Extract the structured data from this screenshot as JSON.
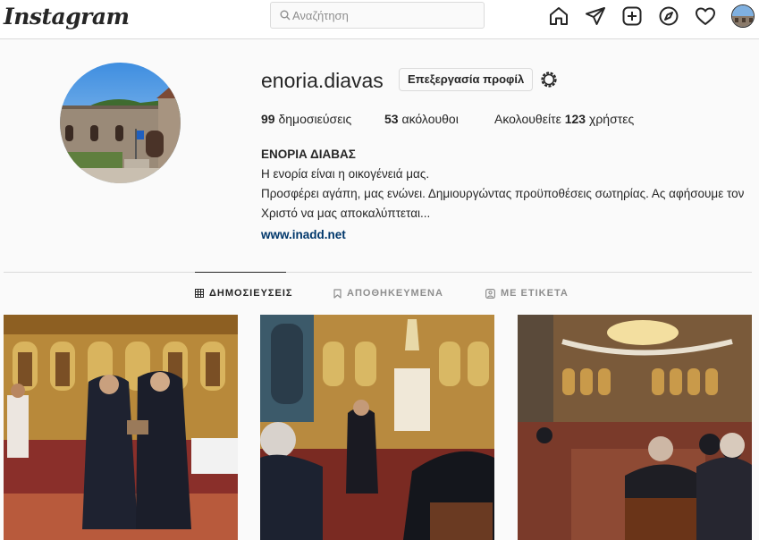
{
  "nav": {
    "logo": "Instagram",
    "search_placeholder": "Αναζήτηση",
    "icons": [
      "home-icon",
      "direct-icon",
      "new-post-icon",
      "explore-icon",
      "activity-icon",
      "profile-avatar"
    ]
  },
  "profile": {
    "username": "enoria.diavas",
    "edit_label": "Επεξεργασία προφίλ",
    "stats": {
      "posts_count": "99",
      "posts_label": "δημοσιεύσεις",
      "followers_count": "53",
      "followers_label": "ακόλουθοι",
      "following_prefix": "Ακολουθείτε",
      "following_count": "123",
      "following_suffix": "χρήστες"
    },
    "bio": {
      "name": "ΕΝΟΡΙΑ ΔΙΑΒΑΣ",
      "line1": "Η ενορία είναι η οικογένειά μας.",
      "line2": "Προσφέρει αγάπη, μας ενώνει. Δημιουργώντας προϋποθέσεις σωτηρίας. Ας αφήσουμε τον Χριστό να μας αποκαλύπτεται...",
      "website": "www.inadd.net"
    }
  },
  "tabs": [
    {
      "label": "ΔΗΜΟΣΙΕΥΣΕΙΣ",
      "active": true
    },
    {
      "label": "ΑΠΟΘΗΚΕΥΜΕΝΑ",
      "active": false
    },
    {
      "label": "ΜΕ ΕΤΙΚΕΤΑ",
      "active": false
    }
  ],
  "colors": {
    "border": "#dbdbdb",
    "text": "#262626",
    "muted": "#8e8e8e",
    "link": "#00376b",
    "background": "#fafafa"
  }
}
